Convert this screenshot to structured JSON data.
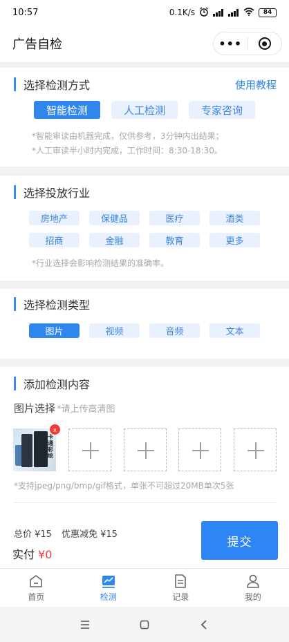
{
  "status_bar": {
    "time": "10:57",
    "net": "0.1K/s",
    "battery": "84"
  },
  "header": {
    "title": "广告自检",
    "more_icon": "more-dots-icon",
    "close_icon": "target-icon"
  },
  "method": {
    "title": "选择检测方式",
    "link": "使用教程",
    "options": [
      "智能检测",
      "人工检测",
      "专家咨询"
    ],
    "selected": "智能检测",
    "notes": [
      "*智能审读由机器完成，仅供参考，3分钟内出结果；",
      "*人工审读半小时内完成，工作时间：8:30-18:30。"
    ]
  },
  "industry": {
    "title": "选择投放行业",
    "options": [
      "房地产",
      "保健品",
      "医疗",
      "酒类",
      "招商",
      "金融",
      "教育",
      "更多"
    ],
    "note": "*行业选择会影响检测结果的准确率。"
  },
  "type": {
    "title": "选择检测类型",
    "options": [
      "图片",
      "视频",
      "音频",
      "文本"
    ],
    "selected": "图片"
  },
  "content": {
    "title": "添加检测内容",
    "image_label": "图片选择",
    "image_hint": "*请上传高清图",
    "thumb_text": "卡通彩绘",
    "delete_label": "x",
    "note": "*支持jpeg/png/bmp/gif格式，单张不可超过20MB单次5张"
  },
  "price": {
    "total": "总价 ¥15",
    "discount": "优惠减免 ¥15",
    "paid_label": "实付 ",
    "paid_value": "¥0",
    "submit": "提交"
  },
  "tabs": [
    {
      "label": "首页",
      "icon": "home-icon"
    },
    {
      "label": "检测",
      "icon": "chart-icon"
    },
    {
      "label": "记录",
      "icon": "document-icon"
    },
    {
      "label": "我的",
      "icon": "user-icon"
    }
  ],
  "active_tab": "检测",
  "colors": {
    "accent": "#2f87ee",
    "chip_bg": "#e8f1fd",
    "price_red": "#e33333"
  }
}
